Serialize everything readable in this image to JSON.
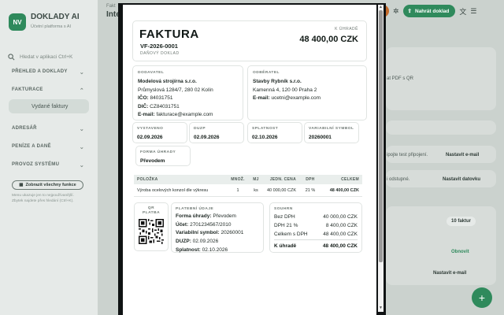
{
  "app": {
    "logo": "NV",
    "name": "DOKLADY AI",
    "subtitle": "Účetní platforma s AI",
    "search_placeholder": "Hledat v aplikaci Ctrl+K",
    "sections": [
      "PŘEHLED A DOKLADY",
      "FAKTURACE",
      "ADRESÁŘ",
      "PENÍZE A DANĚ",
      "PROVOZ SYSTÉMU"
    ],
    "active_item": "Vydané faktury",
    "show_all_button": "Zobrazit všechny funkce",
    "note": "Menu ukazuje jen to nejpoužívanější. Zbytek najdete přes hledání (Ctrl+K)."
  },
  "main": {
    "breadcrumb": "Fakt",
    "title": "Inte",
    "upload_button": "Nahrát doklad",
    "snippets": {
      "pdf_qr": "at PDF s QR",
      "test_connect": "ipojte test připojení.",
      "set_email": "Nastavit e-mail",
      "access": "i odstupné.",
      "set_databox": "Nastavit datovku",
      "invoice_count": "10 faktur",
      "send": "Obnovit",
      "set_email_2": "Nastavit e-mail"
    }
  },
  "invoice": {
    "title": "FAKTURA",
    "number": "VF-2026-0001",
    "doc_type": "DAŇOVÝ DOKLAD",
    "due_label": "K ÚHRADĚ",
    "due_amount": "48 400,00 CZK",
    "supplier": {
      "label": "DODAVATEL",
      "name": "Modelová strojírna s.r.o.",
      "address": "Průmyslová 1284/7, 280 02 Kolín",
      "ico_label": "IČO:",
      "ico": "84031751",
      "dic_label": "DIČ:",
      "dic": "CZ84031751",
      "email_label": "E-mail:",
      "email": "fakturace@example.com"
    },
    "customer": {
      "label": "ODBĚRATEL",
      "name": "Stavby Rybník s.r.o.",
      "address": "Kamenná 4, 120 00 Praha 2",
      "email_label": "E-mail:",
      "email": "ucetni@example.com"
    },
    "dates": {
      "issued_label": "VYSTAVENO",
      "issued": "02.09.2026",
      "duzp_label": "DUZP",
      "duzp": "02.09.2026",
      "due_label": "SPLATNOST",
      "due": "02.10.2026",
      "vs_label": "VARIABILNÍ SYMBOL",
      "vs": "20260001"
    },
    "payment_form": {
      "label": "FORMA ÚHRADY",
      "value": "Převodem"
    },
    "items_headers": [
      "POLOŽKA",
      "MNOŽ.",
      "MJ",
      "JEDN. CENA",
      "DPH",
      "CELKEM"
    ],
    "items": [
      {
        "name": "Výroba ocelových konzol dle výkresu",
        "qty": "1",
        "unit": "ks",
        "unit_price": "40 000,00 CZK",
        "vat": "21 %",
        "total": "48 400,00 CZK"
      }
    ],
    "qr_label_1": "QR",
    "qr_label_2": "PLATBA",
    "payment_info": {
      "label": "PLATEBNÍ ÚDAJE",
      "form_label": "Forma úhrady:",
      "form": "Převodem",
      "account_label": "Účet:",
      "account": "2701234567/2010",
      "vs_label": "Variabilní symbol:",
      "vs": "20260001",
      "duzp_label": "DUZP:",
      "duzp": "02.09.2026",
      "due_label": "Splatnost:",
      "due": "02.10.2026"
    },
    "summary": {
      "label": "SOUHRN",
      "base_label": "Bez DPH",
      "base": "40 000,00 CZK",
      "vat_label": "DPH 21 %",
      "vat": "8 400,00 CZK",
      "gross_label": "Celkem s DPH",
      "gross": "48 400,00 CZK",
      "due_label": "K úhradě",
      "due": "48 400,00 CZK"
    }
  }
}
